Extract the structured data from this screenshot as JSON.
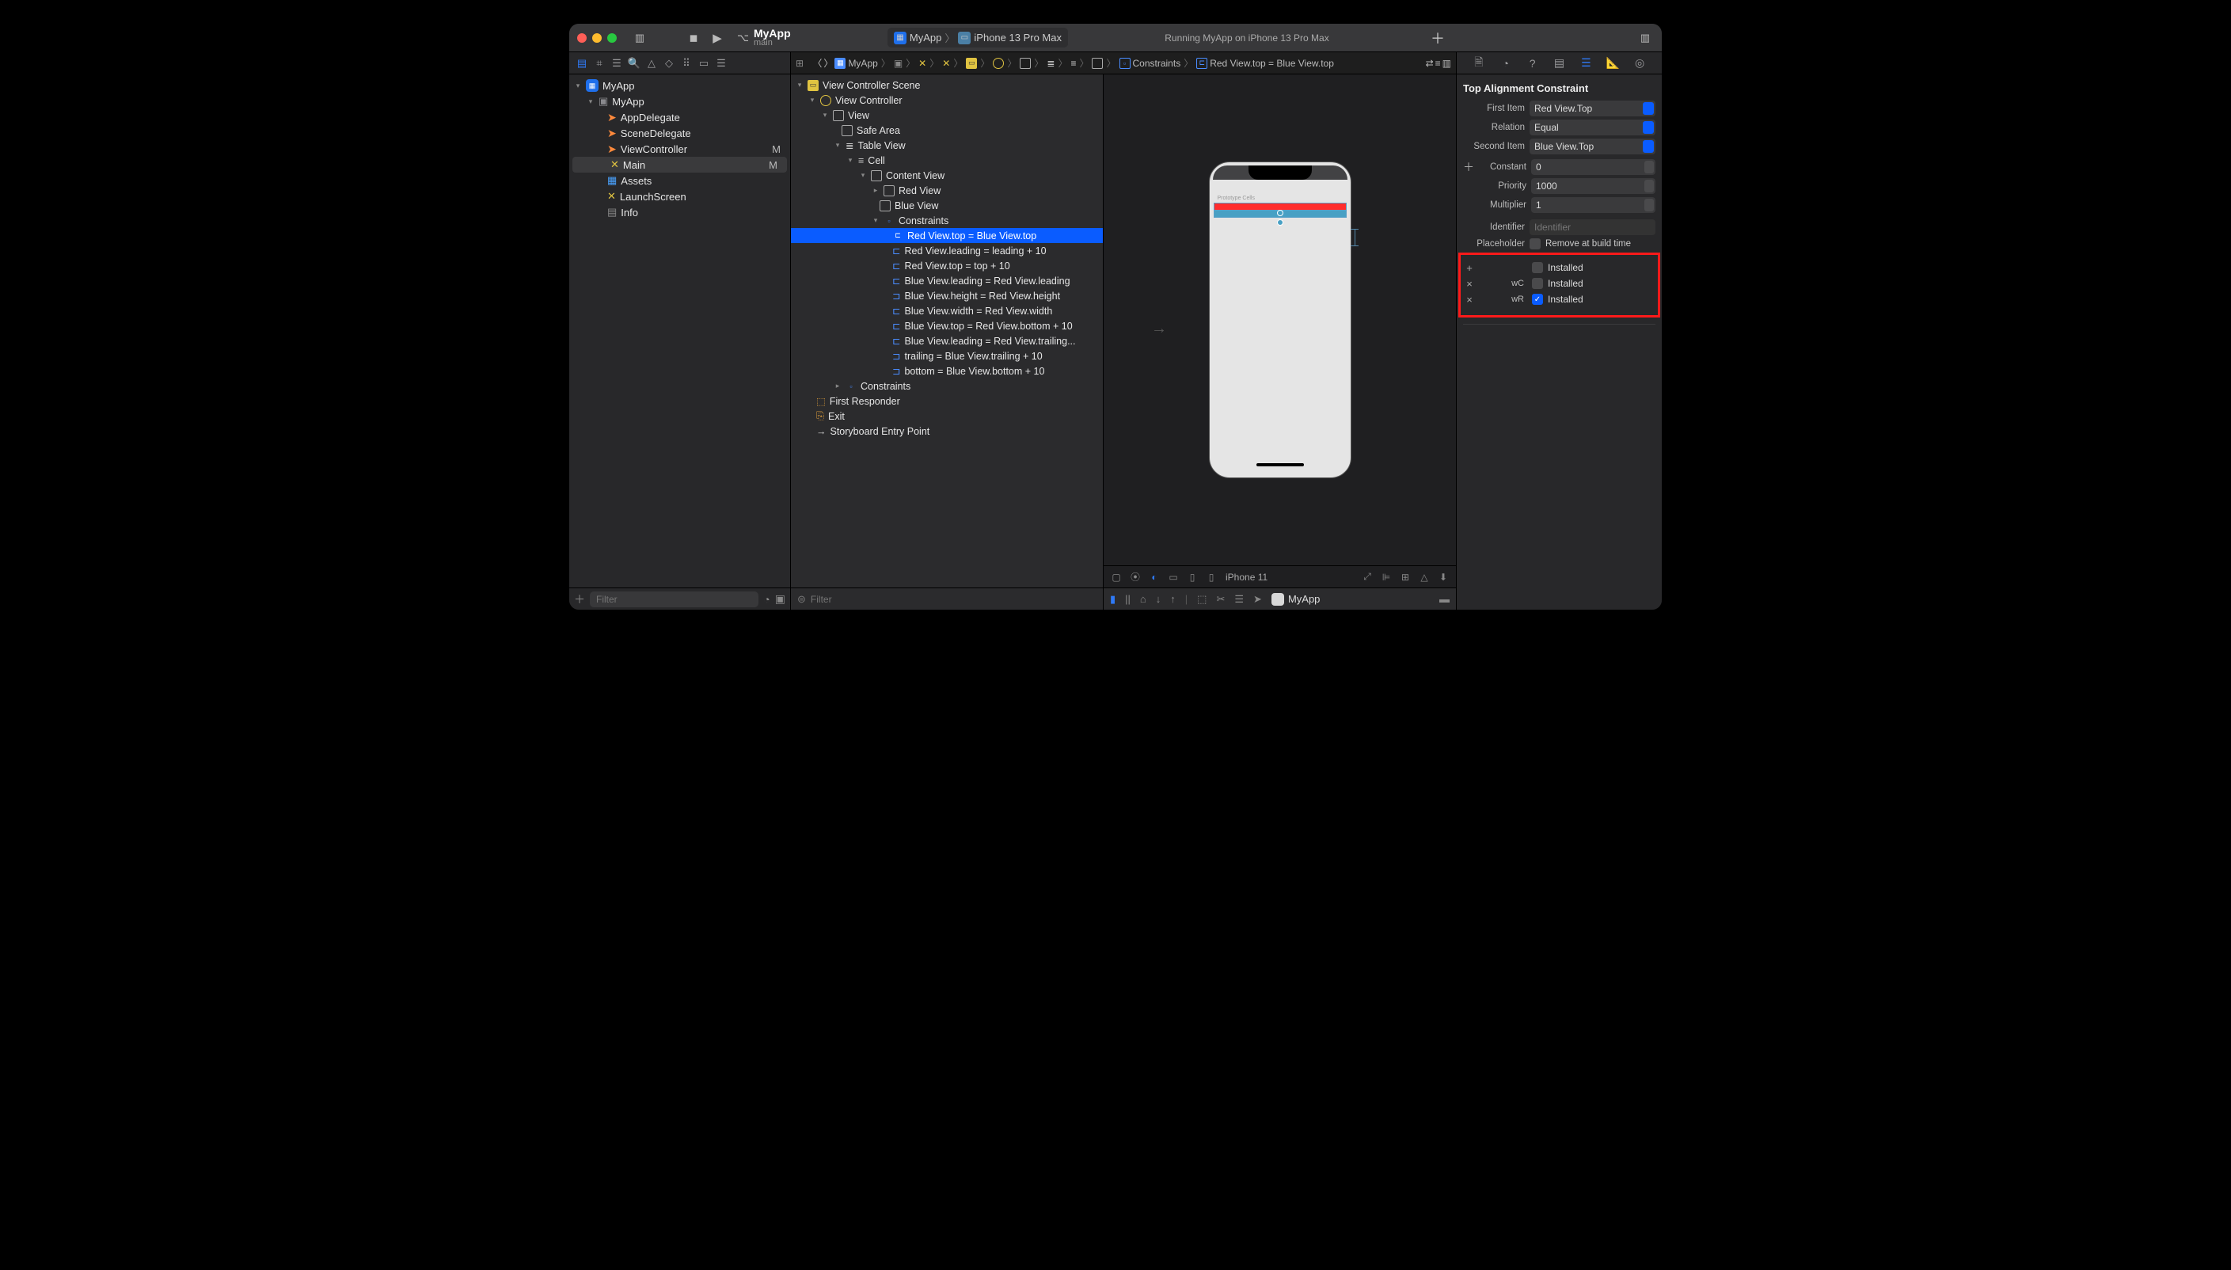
{
  "toolbar": {
    "appName": "MyApp",
    "branch": "main",
    "schemeApp": "MyApp",
    "schemeDevice": "iPhone 13 Pro Max",
    "status": "Running MyApp on iPhone 13 Pro Max"
  },
  "navigator": {
    "project": "MyApp",
    "group": "MyApp",
    "files": {
      "appDelegate": "AppDelegate",
      "sceneDelegate": "SceneDelegate",
      "viewController": {
        "name": "ViewController",
        "status": "M"
      },
      "main": {
        "name": "Main",
        "status": "M"
      },
      "assets": "Assets",
      "launchScreen": "LaunchScreen",
      "info": "Info"
    },
    "filterPlaceholder": "Filter"
  },
  "jumpbar": {
    "items": [
      "MyApp",
      "MyApp",
      "Main",
      "Main (Base)",
      "View Controller Scene",
      "View Controller",
      "View",
      "Table View",
      "Cell",
      "Content View",
      "Constraints",
      "Red View.top = Blue View.top"
    ]
  },
  "outline": {
    "scene": "View Controller Scene",
    "vc": "View Controller",
    "view": "View",
    "safeArea": "Safe Area",
    "tableView": "Table View",
    "cell": "Cell",
    "contentView": "Content View",
    "redView": "Red View",
    "blueView": "Blue View",
    "constraintsGroup": "Constraints",
    "constraints": [
      "Red View.top = Blue View.top",
      "Red View.leading = leading + 10",
      "Red View.top = top + 10",
      "Blue View.leading = Red View.leading",
      "Blue View.height = Red View.height",
      "Blue View.width = Red View.width",
      "Blue View.top = Red View.bottom + 10",
      "Blue View.leading = Red View.trailing...",
      "trailing = Blue View.trailing + 10",
      "bottom = Blue View.bottom + 10"
    ],
    "constraintsBottom": "Constraints",
    "firstResponder": "First Responder",
    "exit": "Exit",
    "storyboardEntry": "Storyboard Entry Point",
    "filterPlaceholder": "Filter",
    "prototypeCells": "Prototype Cells"
  },
  "canvasBottom": {
    "device": "iPhone 11"
  },
  "debug": {
    "appName": "MyApp"
  },
  "inspector": {
    "title": "Top Alignment Constraint",
    "firstItemLabel": "First Item",
    "firstItem": "Red View.Top",
    "relationLabel": "Relation",
    "relation": "Equal",
    "secondItemLabel": "Second Item",
    "secondItem": "Blue View.Top",
    "constantLabel": "Constant",
    "constant": "0",
    "priorityLabel": "Priority",
    "priority": "1000",
    "multiplierLabel": "Multiplier",
    "multiplier": "1",
    "identifierLabel": "Identifier",
    "identifierPlaceholder": "Identifier",
    "placeholderLabel": "Placeholder",
    "placeholderOption": "Remove at build time",
    "installed": [
      {
        "icon": "+",
        "sizeClass": "",
        "checked": false,
        "label": "Installed"
      },
      {
        "icon": "×",
        "sizeClass": "wC",
        "checked": false,
        "label": "Installed"
      },
      {
        "icon": "×",
        "sizeClass": "wR",
        "checked": true,
        "label": "Installed"
      }
    ]
  }
}
